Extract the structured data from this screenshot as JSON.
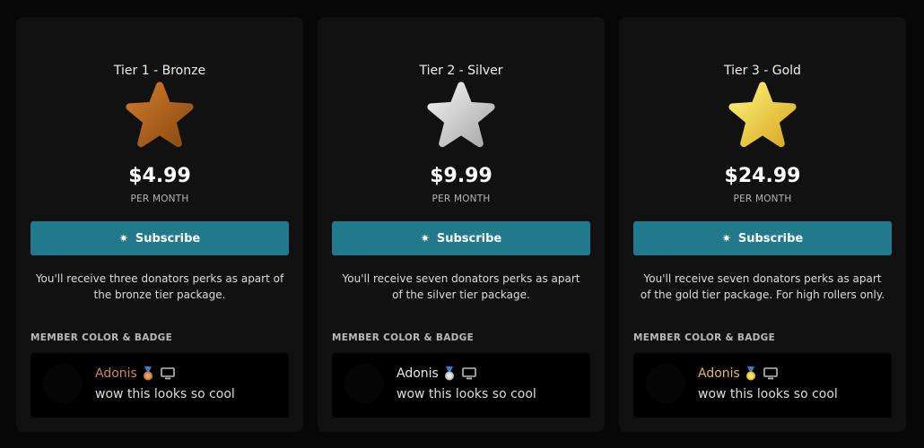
{
  "tiers": [
    {
      "title": "Tier 1 - Bronze",
      "price": "$4.99",
      "period": "PER MONTH",
      "subscribe_label": "Subscribe",
      "description": "You'll receive three donators perks as apart of the bronze tier package.",
      "section_label": "MEMBER COLOR & BADGE",
      "preview": {
        "name": "Adonis",
        "message": "wow this looks so cool"
      },
      "star_icon": "bronze-star-icon",
      "colors": {
        "star": "#b5651d",
        "name": "#d0894c",
        "medal": "#cd7f32"
      }
    },
    {
      "title": "Tier 2 - Silver",
      "price": "$9.99",
      "period": "PER MONTH",
      "subscribe_label": "Subscribe",
      "description": "You'll receive seven donators perks as apart of the silver tier package.",
      "section_label": "MEMBER COLOR & BADGE",
      "preview": {
        "name": "Adonis",
        "message": "wow this looks so cool"
      },
      "star_icon": "silver-star-icon",
      "colors": {
        "star": "#d9d9d9",
        "name": "#e8e8e8",
        "medal": "#c0c0c0"
      }
    },
    {
      "title": "Tier 3 - Gold",
      "price": "$24.99",
      "period": "PER MONTH",
      "subscribe_label": "Subscribe",
      "description": "You'll receive seven donators perks as apart of the gold tier package. For high rollers only.",
      "section_label": "MEMBER COLOR & BADGE",
      "preview": {
        "name": "Adonis",
        "message": "wow this looks so cool"
      },
      "star_icon": "gold-star-icon",
      "colors": {
        "star": "#f2d64b",
        "name": "#e8b84a",
        "medal": "#f0c419"
      }
    }
  ],
  "colors": {
    "background": "#070707",
    "card": "#111111",
    "button": "#217a8c",
    "preview": "#000000"
  }
}
